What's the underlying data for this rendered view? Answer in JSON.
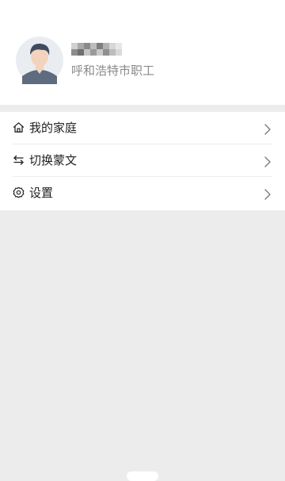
{
  "profile": {
    "subtitle": "呼和浩特市职工",
    "avatar_icon": "user-avatar-icon"
  },
  "menu": {
    "items": [
      {
        "label": "我的家庭",
        "icon": "home-icon"
      },
      {
        "label": "切换蒙文",
        "icon": "swap-arrows-icon"
      },
      {
        "label": "设置",
        "icon": "gear-icon"
      }
    ]
  },
  "colors": {
    "background": "#ececec",
    "card": "#ffffff",
    "text_primary": "#222222",
    "text_secondary": "#8a8a8a"
  }
}
